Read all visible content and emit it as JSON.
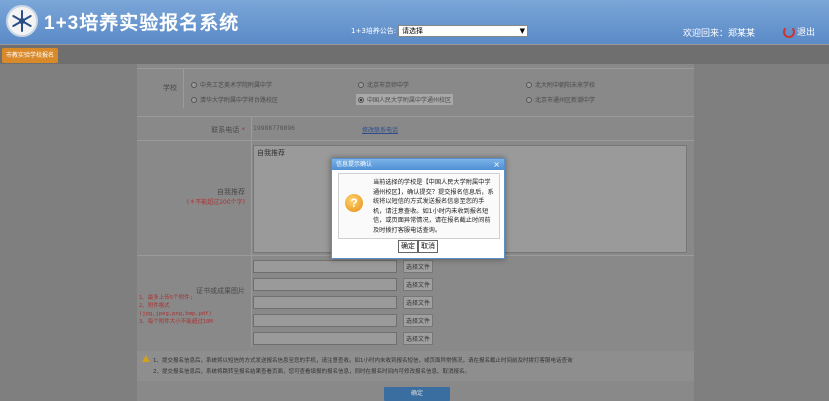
{
  "header": {
    "title": "1+3培养实验报名系统",
    "notice_label": "1+3培养公告:",
    "notice_select_value": "请选择",
    "welcome": "欢迎回来：郑某某",
    "logout": "退出"
  },
  "nav": {
    "tab_label": "市教实验学校报名"
  },
  "form": {
    "school_label": "学校",
    "schools": [
      "中央工艺美术学院附属中学",
      "北京市京师中学",
      "北大附中朝阳未来学校",
      "清华大学附属中学将台路校区",
      "中国人民大学附属中学通州校区",
      "北京市通州区新潮中学"
    ],
    "selected_school_index": 4,
    "phone_label": "联系电话",
    "required_mark": "*",
    "phone_value": "19988778896",
    "phone_link": "修改联系电话",
    "self_label": "自我推荐",
    "self_hint": "(＊不能超过200个字)",
    "self_placeholder": "自我推荐",
    "cert_label": "证书或成果图片",
    "cert_notes": [
      "1、最多上传5个附件;",
      "2、附件格式",
      "(jpg,jpeg,png,bmp,pdf)",
      "3、每个附件大小不能超过10M"
    ],
    "file_button": "选择文件",
    "notes": [
      "1、提交报名信息后，系统将以短信的方式发送报名信息至您的手机，请注意查收。如1小时内未收到报名短信，或页面异常情况，请在报名截止时间前及时拨打客服电话查询",
      "2、提交报名信息后，系统将跳转至报名结果查看页面，您可查看填报的报名信息，同时在报名时间内可修改报名信息、取消报名。"
    ],
    "submit": "确定"
  },
  "dialog": {
    "title": "信息提示确认",
    "close": "×",
    "icon": "?",
    "message": "当前选择的学校是【中国人民大学附属中学通州校区】，确认提交？提交报名信息后，系统将以短信的方式发送报名信息至您的手机，请注意查收。如1小时内未收到报名短信，或页面异常情况，请在报名截止时间前及时拨打客服电话查询。",
    "ok": "确定",
    "cancel": "取消"
  }
}
